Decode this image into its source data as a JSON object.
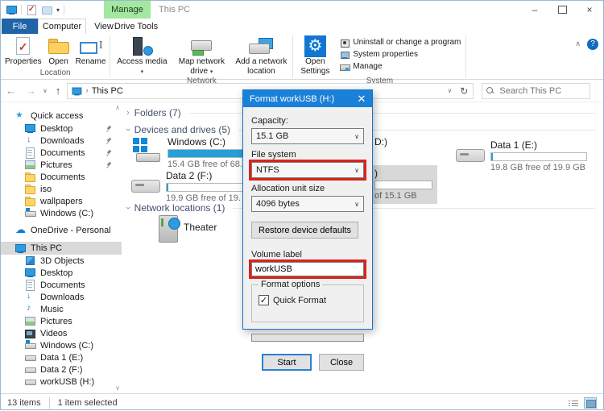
{
  "colors": {
    "accent_blue": "#1a80d8",
    "annotation_red": "#d8231d",
    "manage_tab_green": "#a4e7a0",
    "file_tab_blue": "#2063a7",
    "capacity_bar_blue": "#26a0da",
    "selection_grey": "#d9d9d9"
  },
  "titlebar": {
    "title": "This PC",
    "manage_tab": "Manage"
  },
  "tabs": {
    "file": "File",
    "computer": "Computer",
    "view": "View",
    "drive_tools": "Drive Tools"
  },
  "ribbon": {
    "location": {
      "group_label": "Location",
      "buttons": [
        {
          "label": "Properties",
          "icon": "properties"
        },
        {
          "label": "Open",
          "icon": "open-folder"
        },
        {
          "label": "Rename",
          "icon": "rename"
        }
      ]
    },
    "network": {
      "group_label": "Network",
      "buttons": [
        {
          "label": "Access media",
          "icon": "access-media",
          "dropdown": "▾"
        },
        {
          "label": "Map network drive",
          "icon": "map-drive",
          "dropdown": "▾"
        },
        {
          "label": "Add a network location",
          "icon": "add-location"
        }
      ]
    },
    "system": {
      "group_label": "System",
      "open_settings": "Open Settings",
      "items": [
        {
          "label": "Uninstall or change a program",
          "icon": "uninstall"
        },
        {
          "label": "System properties",
          "icon": "sysprops"
        },
        {
          "label": "Manage",
          "icon": "manage-sm"
        }
      ]
    }
  },
  "addressbar": {
    "breadcrumb": "This PC",
    "search_placeholder": "Search This PC"
  },
  "sidebar": {
    "quick_access": "Quick access",
    "quick_items": [
      {
        "label": "Desktop",
        "icon": "monitor",
        "pin": "true"
      },
      {
        "label": "Downloads",
        "icon": "download",
        "pin": "true"
      },
      {
        "label": "Documents",
        "icon": "doc",
        "pin": "true"
      },
      {
        "label": "Pictures",
        "icon": "pictures",
        "pin": "true"
      },
      {
        "label": "Documents",
        "icon": "folder"
      },
      {
        "label": "iso",
        "icon": "folder"
      },
      {
        "label": "wallpapers",
        "icon": "folder"
      },
      {
        "label": "Windows (C:)",
        "icon": "drive-os"
      }
    ],
    "onedrive": "OneDrive - Personal",
    "this_pc": "This PC",
    "pc_items": [
      {
        "label": "3D Objects",
        "icon": "cube"
      },
      {
        "label": "Desktop",
        "icon": "monitor"
      },
      {
        "label": "Documents",
        "icon": "doc"
      },
      {
        "label": "Downloads",
        "icon": "download"
      },
      {
        "label": "Music",
        "icon": "music"
      },
      {
        "label": "Pictures",
        "icon": "pictures"
      },
      {
        "label": "Videos",
        "icon": "video"
      },
      {
        "label": "Windows (C:)",
        "icon": "drive-os"
      },
      {
        "label": "Data 1 (E:)",
        "icon": "drive"
      },
      {
        "label": "Data 2 (F:)",
        "icon": "drive"
      },
      {
        "label": "workUSB (H:)",
        "icon": "drive"
      }
    ]
  },
  "content": {
    "folders_header": "Folders (7)",
    "devices_header": "Devices and drives (5)",
    "network_header": "Network locations (1)",
    "drive_c": {
      "name": "Windows (C:)",
      "detail": "15.4 GB free of 68.",
      "fill": "90%"
    },
    "drive_f": {
      "name": "Data 2 (F:)",
      "detail": "19.9 GB free of 19.",
      "fill": "2%"
    },
    "drive_e": {
      "name": "Data 1 (E:)",
      "detail": "19.8 GB free of 19.9 GB",
      "fill": "2%"
    },
    "drive_d_fragment": "D:)",
    "workusb_fragment": {
      "name": ")",
      "detail": "of 15.1 GB"
    },
    "network_item": "Theater"
  },
  "dialog": {
    "title": "Format workUSB (H:)",
    "capacity_label": "Capacity:",
    "capacity_value": "15.1 GB",
    "filesystem_label": "File system",
    "filesystem_value": "NTFS",
    "alloc_label": "Allocation unit size",
    "alloc_value": "4096 bytes",
    "restore_button": "Restore device defaults",
    "volume_label": "Volume label",
    "volume_value": "workUSB",
    "format_options_label": "Format options",
    "quick_format_label": "Quick Format",
    "start_button": "Start",
    "close_button": "Close"
  },
  "statusbar": {
    "items": "13 items",
    "selected": "1 item selected"
  }
}
